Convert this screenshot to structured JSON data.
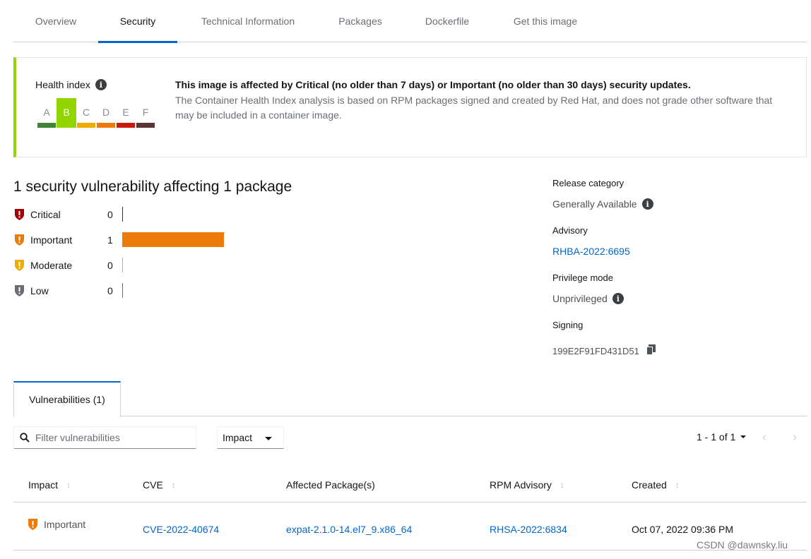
{
  "tabs": [
    {
      "label": "Overview"
    },
    {
      "label": "Security"
    },
    {
      "label": "Technical Information"
    },
    {
      "label": "Packages"
    },
    {
      "label": "Dockerfile"
    },
    {
      "label": "Get this image"
    }
  ],
  "active_tab": "Security",
  "health": {
    "label": "Health index",
    "grades": [
      {
        "letter": "A",
        "color": "#3e8635"
      },
      {
        "letter": "B",
        "color": "#92d400"
      },
      {
        "letter": "C",
        "color": "#f0ab00"
      },
      {
        "letter": "D",
        "color": "#ec7a08"
      },
      {
        "letter": "E",
        "color": "#c9190b"
      },
      {
        "letter": "F",
        "color": "#5c3533"
      }
    ],
    "active_grade": "B",
    "title": "This image is affected by Critical (no older than 7 days) or Important (no older than 30 days) security updates.",
    "description": "The Container Health Index analysis is based on RPM packages signed and created by Red Hat, and does not grade other software that may be included in a container image."
  },
  "vulnerabilities": {
    "title": "1 security vulnerability affecting 1 package",
    "severities": [
      {
        "name": "Critical",
        "count": "0",
        "color": "#a30000"
      },
      {
        "name": "Important",
        "count": "1",
        "color": "#ec7a08"
      },
      {
        "name": "Moderate",
        "count": "0",
        "color": "#f0ab00"
      },
      {
        "name": "Low",
        "count": "0",
        "color": "#6a6e73"
      }
    ],
    "max_count": 1
  },
  "meta": {
    "release_label": "Release category",
    "release_value": "Generally Available",
    "advisory_label": "Advisory",
    "advisory_value": "RHBA-2022:6695",
    "privilege_label": "Privilege mode",
    "privilege_value": "Unprivileged",
    "signing_label": "Signing",
    "signing_value": "199E2F91FD431D51"
  },
  "lower_tab": "Vulnerabilities (1)",
  "toolbar": {
    "filter_placeholder": "Filter vulnerabilities",
    "impact_select": "Impact",
    "pagination": "1 - 1 of 1"
  },
  "table": {
    "columns": [
      "Impact",
      "CVE",
      "Affected Package(s)",
      "RPM Advisory",
      "Created"
    ],
    "rows": [
      {
        "impact": "Important",
        "cve": "CVE-2022-40674",
        "package": "expat-2.1.0-14.el7_9.x86_64",
        "advisory": "RHSA-2022:6834",
        "created": "Oct 07, 2022 09:36 PM"
      }
    ]
  },
  "watermark": "CSDN @dawnsky.liu"
}
